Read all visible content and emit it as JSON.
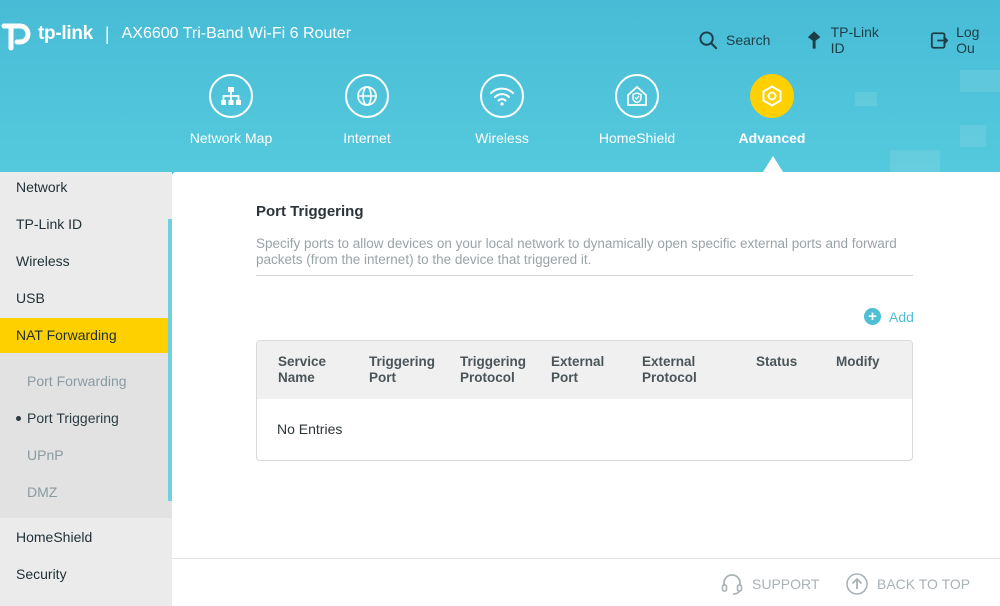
{
  "header": {
    "brand": "tp-link",
    "separator": "|",
    "model": "AX6600 Tri-Band Wi-Fi 6 Router",
    "links": [
      {
        "label": "Search",
        "icon": "search-icon"
      },
      {
        "label": "TP-Link ID",
        "icon": "tplink-id-icon"
      },
      {
        "label": "Log Ou",
        "icon": "logout-icon"
      }
    ]
  },
  "nav": {
    "items": [
      {
        "label": "Network Map",
        "icon": "network-map-icon"
      },
      {
        "label": "Internet",
        "icon": "globe-icon"
      },
      {
        "label": "Wireless",
        "icon": "wifi-icon"
      },
      {
        "label": "HomeShield",
        "icon": "home-shield-icon"
      },
      {
        "label": "Advanced",
        "icon": "gear-icon",
        "active": true
      }
    ]
  },
  "sidebar": {
    "items": [
      {
        "label": "Network"
      },
      {
        "label": "TP-Link ID"
      },
      {
        "label": "Wireless"
      },
      {
        "label": "USB"
      },
      {
        "label": "NAT Forwarding",
        "active": true
      },
      {
        "label": "HomeShield"
      },
      {
        "label": "Security"
      }
    ],
    "subitems": [
      {
        "label": "Port Forwarding"
      },
      {
        "label": "Port Triggering",
        "active": true
      },
      {
        "label": "UPnP"
      },
      {
        "label": "DMZ"
      }
    ]
  },
  "main": {
    "title": "Port Triggering",
    "description": "Specify ports to allow devices on your local network to dynamically open specific external ports and forward packets (from the internet) to the device that triggered it.",
    "add_label": "Add",
    "table": {
      "headers": [
        {
          "line1": "Service",
          "line2": "Name"
        },
        {
          "line1": "Triggering",
          "line2": "Port"
        },
        {
          "line1": "Triggering",
          "line2": "Protocol"
        },
        {
          "line1": "External",
          "line2": "Port"
        },
        {
          "line1": "External",
          "line2": "Protocol"
        },
        {
          "line1": "Status",
          "line2": ""
        },
        {
          "line1": "Modify",
          "line2": ""
        }
      ],
      "empty_text": "No Entries"
    }
  },
  "footer": {
    "support_label": "SUPPORT",
    "back_to_top_label": "BACK TO TOP"
  },
  "colors": {
    "header_bg": "#4ec3d8",
    "accent_yellow": "#ffd000",
    "link_teal": "#4fbfd3"
  }
}
